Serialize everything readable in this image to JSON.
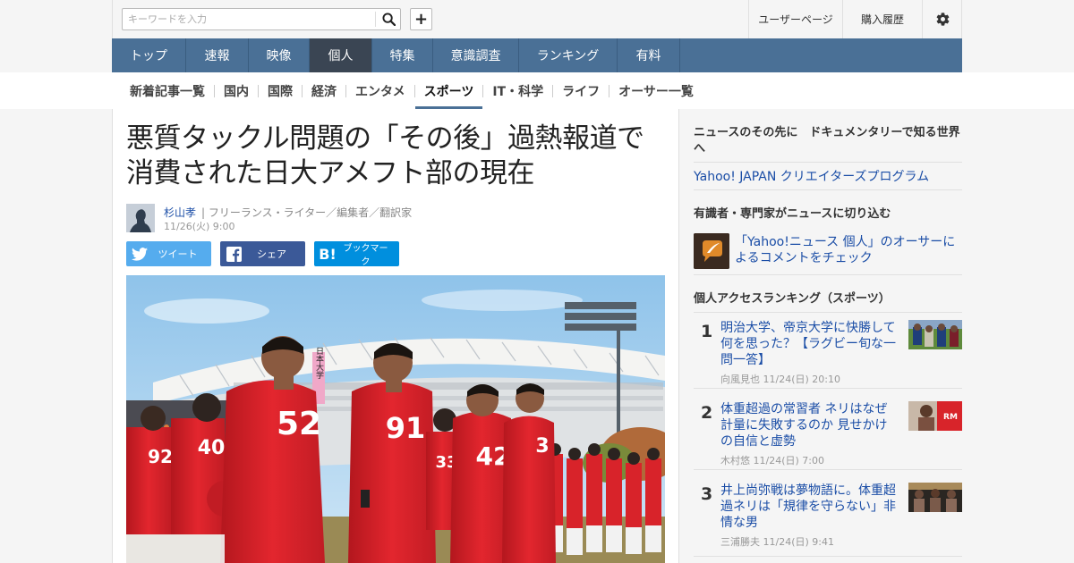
{
  "header": {
    "search_placeholder": "キーワードを入力",
    "user_page": "ユーザーページ",
    "purchase_history": "購入履歴"
  },
  "global_nav": [
    "トップ",
    "速報",
    "映像",
    "個人",
    "特集",
    "意識調査",
    "ランキング",
    "有料"
  ],
  "global_nav_active": "個人",
  "sub_nav": [
    "新着記事一覧",
    "国内",
    "国際",
    "経済",
    "エンタメ",
    "スポーツ",
    "IT・科学",
    "ライフ",
    "オーサー一覧"
  ],
  "sub_nav_active": "スポーツ",
  "article": {
    "title_line1": "悪質タックル問題の「その後」過熱報道で",
    "title_line2": "消費された日大アメフト部の現在",
    "author": "杉山孝",
    "author_role": "| フリーランス・ライター／編集者／翻訳家",
    "date": "11/26(火) 9:00",
    "share_tweet": "ツイート",
    "share_facebook": "シェア",
    "share_hatena": "ブックマーク",
    "photo_jersey_numbers": [
      "52",
      "91",
      "42",
      "3",
      "92",
      "40",
      "33"
    ],
    "photo_banner_text": "日本大学"
  },
  "sidebar": {
    "promo_heading": "ニュースのその先に　ドキュメンタリーで知る世界へ",
    "promo_link": "Yahoo! JAPAN クリエイターズプログラム",
    "expert_heading": "有識者・専門家がニュースに切り込む",
    "expert_text": "「Yahoo!ニュース 個人」のオーサーによるコメントをチェック",
    "ranking_heading": "個人アクセスランキング（スポーツ）",
    "ranking": [
      {
        "rank": "1",
        "title": "明治大学、帝京大学に快勝して何を思った？【ラグビー旬な一問一答】",
        "author": "向風見也",
        "date": "11/24(日) 20:10"
      },
      {
        "rank": "2",
        "title": "体重超過の常習者 ネリはなぜ計量に失敗するのか 見せかけの自信と虚勢",
        "author": "木村悠",
        "date": "11/24(日) 7:00"
      },
      {
        "rank": "3",
        "title": "井上尚弥戦は夢物語に。体重超過ネリは「規律を守らない」非情な男",
        "author": "三浦勝夫",
        "date": "11/24(日) 9:41"
      }
    ]
  },
  "colors": {
    "nav_bg": "#4a7096",
    "nav_active": "#3a4553",
    "link": "#1a4da6",
    "tweet": "#55acee",
    "facebook": "#3b5998",
    "hatena": "#008fde",
    "jersey_red": "#d8232a"
  }
}
